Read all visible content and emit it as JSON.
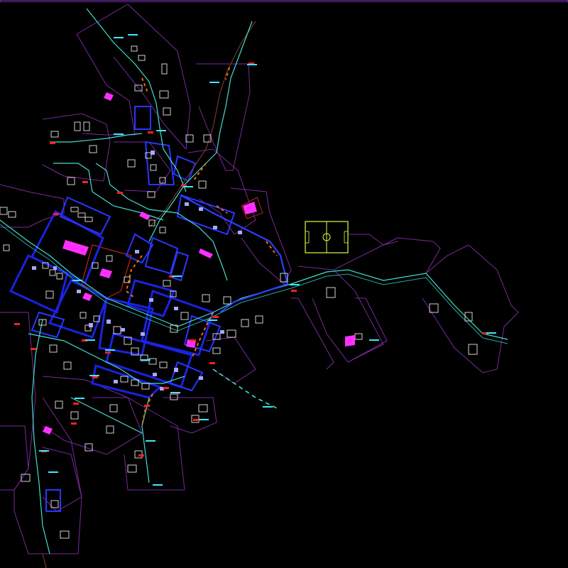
{
  "drawing": {
    "background": "#000000",
    "colors": {
      "parcel": "#7a2a9a",
      "block": "#1a22e0",
      "road_cyan": "#3fe0d0",
      "road_orange": "#ff6a00",
      "building": "#e8e8e8",
      "marker_red": "#ff2020",
      "marker_cyan": "#40e8ff",
      "public_building": "#ff30ff",
      "sports_field": "#d8ff40",
      "red_boundary": "#c02020"
    },
    "layers": [
      "parcels",
      "blocks",
      "roads",
      "buildings",
      "markers",
      "sports-field"
    ],
    "icons": [
      "soccer-field-icon"
    ]
  }
}
